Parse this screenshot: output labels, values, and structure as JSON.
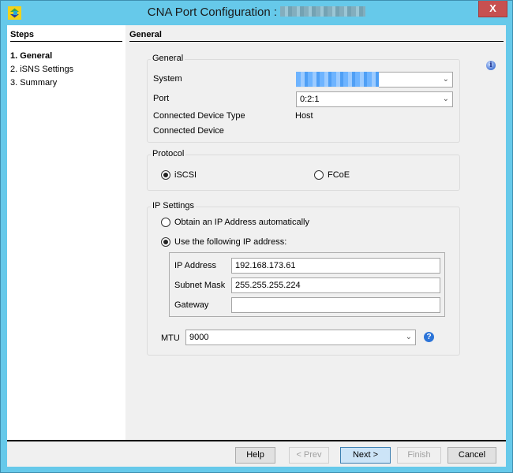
{
  "window": {
    "title": "CNA Port Configuration : ",
    "title_redacted": "",
    "close_label": "X"
  },
  "steps": {
    "header": "Steps",
    "items": [
      {
        "label": "1. General",
        "active": true
      },
      {
        "label": "2. iSNS Settings",
        "active": false
      },
      {
        "label": "3. Summary",
        "active": false
      }
    ]
  },
  "main": {
    "header": "General",
    "info_icon": "i",
    "general_group": {
      "legend": "General",
      "system_label": "System",
      "system_value": "",
      "port_label": "Port",
      "port_value": "0:2:1",
      "device_type_label": "Connected Device Type",
      "device_type_value": "Host",
      "device_label": "Connected Device",
      "device_value": ""
    },
    "protocol_group": {
      "legend": "Protocol",
      "options": [
        {
          "label": "iSCSI",
          "selected": true
        },
        {
          "label": "FCoE",
          "selected": false
        }
      ]
    },
    "ip_group": {
      "legend": "IP Settings",
      "auto_label": "Obtain an IP Address automatically",
      "auto_selected": false,
      "manual_label": "Use the following IP address:",
      "manual_selected": true,
      "ip_label": "IP Address",
      "ip_value": "192.168.173.61",
      "subnet_label": "Subnet Mask",
      "subnet_value": "255.255.255.224",
      "gateway_label": "Gateway",
      "gateway_value": "",
      "mtu_label": "MTU",
      "mtu_value": "9000",
      "help_icon": "?"
    }
  },
  "footer": {
    "help": "Help",
    "prev": "< Prev",
    "next": "Next >",
    "finish": "Finish",
    "cancel": "Cancel"
  },
  "icons": {
    "chevron": "⌄"
  }
}
